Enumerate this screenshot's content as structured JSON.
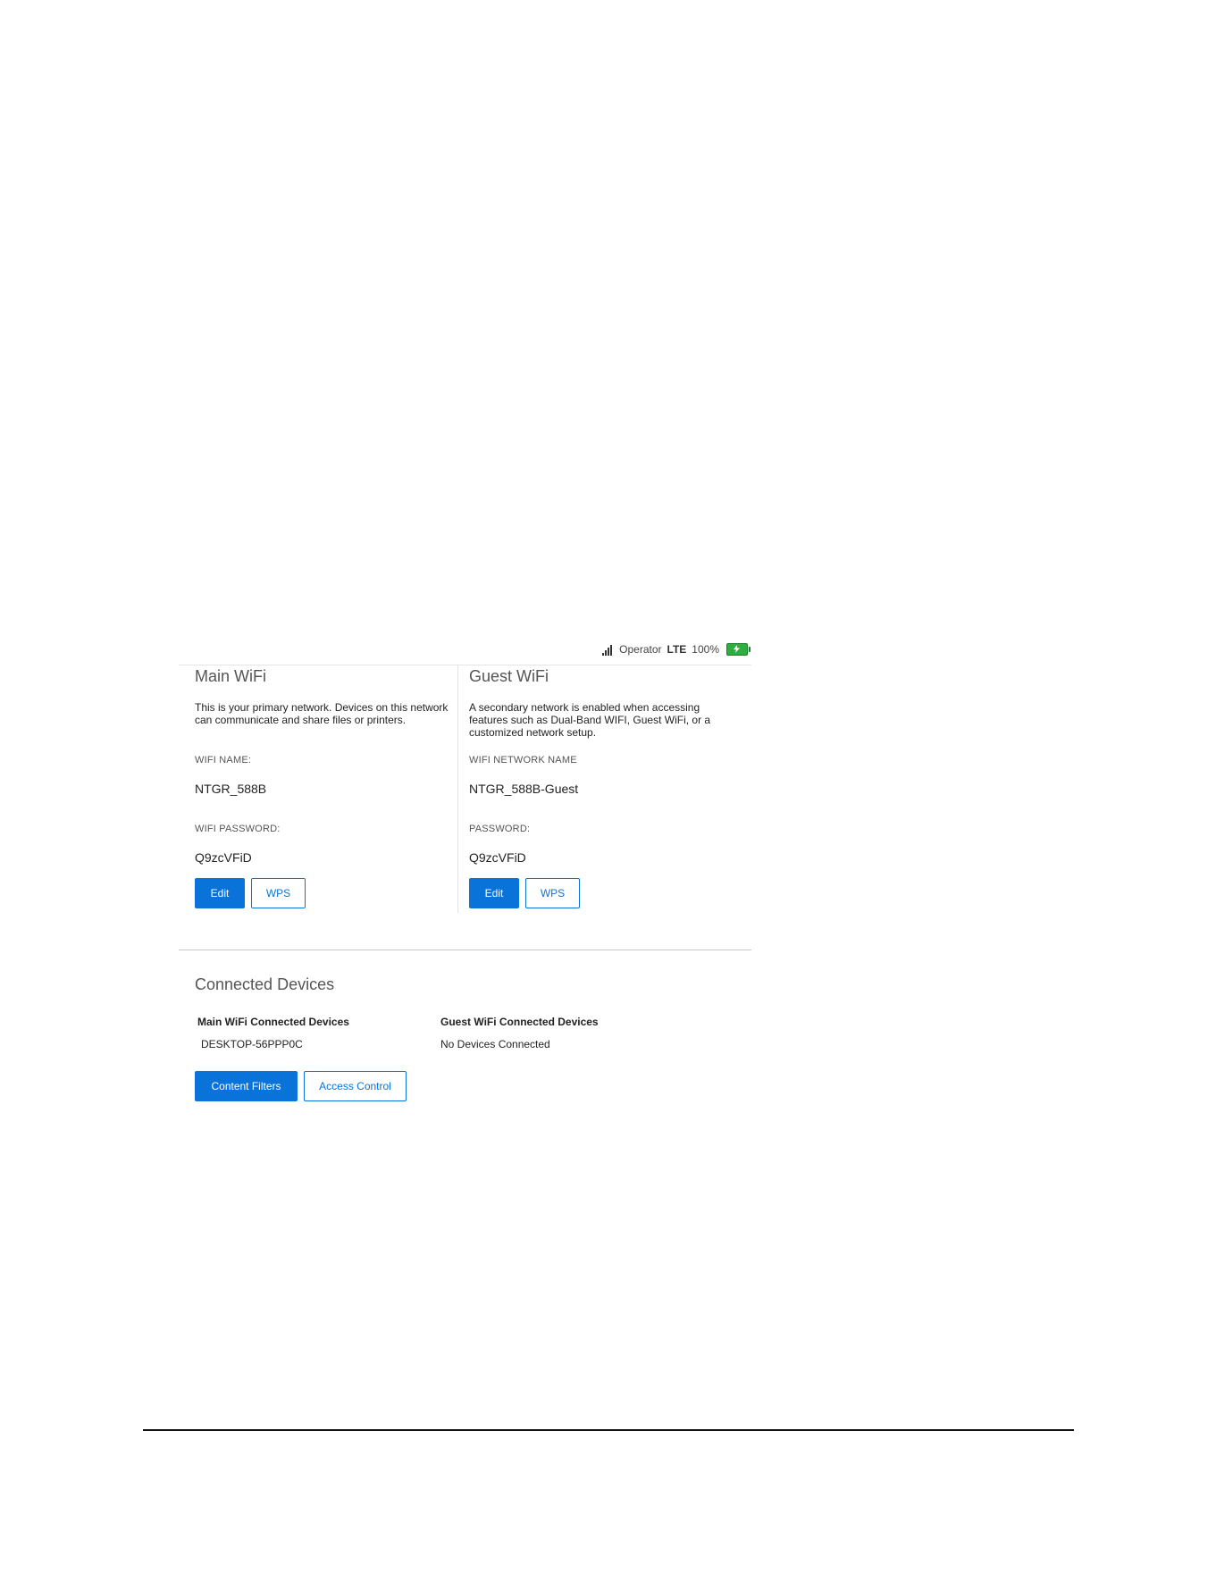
{
  "status": {
    "operator": "Operator",
    "network": "LTE",
    "battery": "100%",
    "battery_color": "#2eae3f",
    "signal_icon": "signal-bars-icon",
    "battery_icon": "battery-charging-icon"
  },
  "main_wifi": {
    "title": "Main WiFi",
    "description": "This is your primary network. Devices on this network can communicate and share files or printers.",
    "name_label": "WIFI NAME:",
    "name_value": "NTGR_588B",
    "password_label": "WIFI PASSWORD:",
    "password_value": "Q9zcVFiD",
    "edit_label": "Edit",
    "wps_label": "WPS"
  },
  "guest_wifi": {
    "title": "Guest WiFi",
    "description": "A secondary network is enabled when accessing features such as Dual-Band WIFI, Guest WiFi, or a customized network setup.",
    "name_label": "WIFI NETWORK NAME",
    "name_value": "NTGR_588B-Guest",
    "password_label": "PASSWORD:",
    "password_value": "Q9zcVFiD",
    "edit_label": "Edit",
    "wps_label": "WPS"
  },
  "connected_devices": {
    "title": "Connected Devices",
    "main_header": "Main WiFi Connected Devices",
    "main_devices": [
      "DESKTOP-56PPP0C"
    ],
    "guest_header": "Guest WiFi Connected Devices",
    "guest_devices": [
      "No Devices Connected"
    ],
    "content_filters_label": "Content Filters",
    "access_control_label": "Access Control"
  },
  "colors": {
    "accent": "#0a73d9",
    "divider": "#e4e4e4"
  }
}
